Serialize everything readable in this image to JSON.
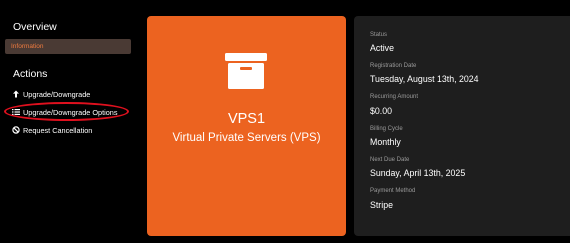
{
  "sidebar": {
    "overview_heading": "Overview",
    "information_label": "Information",
    "actions_heading": "Actions",
    "actions": [
      {
        "label": "Upgrade/Downgrade",
        "icon": "arrow-up-icon"
      },
      {
        "label": "Upgrade/Downgrade Options",
        "icon": "list-icon"
      },
      {
        "label": "Request Cancellation",
        "icon": "ban-icon"
      }
    ]
  },
  "product": {
    "name": "VPS1",
    "group": "Virtual Private Servers (VPS)",
    "icon": "archive-box-icon"
  },
  "details": {
    "status_label": "Status",
    "status_value": "Active",
    "registration_label": "Registration Date",
    "registration_value": "Tuesday, August 13th, 2024",
    "recurring_label": "Recurring Amount",
    "recurring_value": "$0.00",
    "billing_label": "Billing Cycle",
    "billing_value": "Monthly",
    "next_due_label": "Next Due Date",
    "next_due_value": "Sunday, April 13th, 2025",
    "payment_label": "Payment Method",
    "payment_value": "Stripe"
  },
  "colors": {
    "accent": "#ec6320",
    "active_item_text": "#f07b3f",
    "highlight": "#e0101e",
    "panel": "#1e1e1e"
  }
}
